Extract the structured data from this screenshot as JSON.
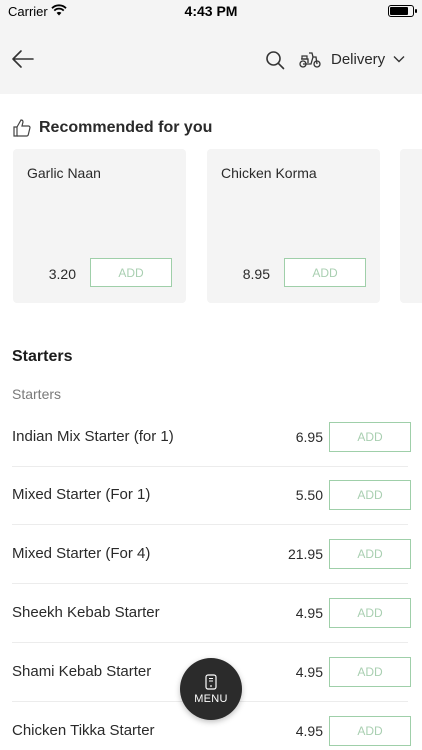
{
  "status_bar": {
    "carrier": "Carrier",
    "time": "4:43 PM",
    "battery_level": 0.9
  },
  "header": {
    "delivery_label": "Delivery",
    "icons": [
      "back-arrow-icon",
      "search-icon",
      "scooter-icon",
      "chevron-down-icon"
    ]
  },
  "recommended": {
    "title": "Recommended for you",
    "items": [
      {
        "name": "Garlic Naan",
        "price": "3.20",
        "add_label": "ADD"
      },
      {
        "name": "Chicken Korma",
        "price": "8.95",
        "add_label": "ADD"
      }
    ]
  },
  "starters": {
    "title": "Starters",
    "subtitle": "Starters",
    "items": [
      {
        "name": "Indian Mix Starter (for 1)",
        "price": "6.95",
        "add_label": "ADD"
      },
      {
        "name": "Mixed Starter (For 1)",
        "price": "5.50",
        "add_label": "ADD"
      },
      {
        "name": "Mixed Starter (For 4)",
        "price": "21.95",
        "add_label": "ADD"
      },
      {
        "name": "Sheekh Kebab Starter",
        "price": "4.95",
        "add_label": "ADD"
      },
      {
        "name": "Shami Kebab Starter",
        "price": "4.95",
        "add_label": "ADD"
      },
      {
        "name": "Chicken Tikka Starter",
        "price": "4.95",
        "add_label": "ADD"
      }
    ]
  },
  "menu_button": {
    "label": "MENU"
  },
  "colors": {
    "add_border": "#9fcfa9",
    "add_text": "#a9cfb1",
    "header_bg": "#f4f4f4",
    "fab_bg": "#2b2b2b"
  }
}
